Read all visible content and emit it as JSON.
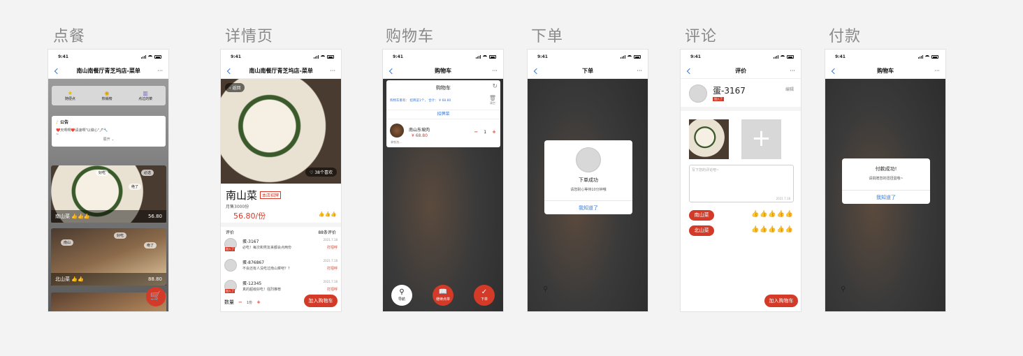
{
  "section_titles": [
    "点餐",
    "详情页",
    "购物车",
    "下单",
    "评论",
    "付款"
  ],
  "status_time": "9:41",
  "more_label": "···",
  "screens": {
    "order": {
      "nav_title": "南山南餐厅青芝坞店-菜单",
      "shortcuts": [
        {
          "icon": "star-icon",
          "label": "随便点"
        },
        {
          "icon": "medal-icon",
          "label": "热销榜"
        },
        {
          "icon": "chart-icon",
          "label": "点过的菜"
        }
      ],
      "notice_title": "公告",
      "notice_text": "❤️天啊啊❤️请速啊\"以做心\"🖊🔧",
      "notice_dash": "~",
      "notice_expand": "展开",
      "dishes": [
        {
          "name": "南山菜",
          "price": "56.80",
          "tags": [
            "好吃",
            "必选",
            "绝了"
          ]
        },
        {
          "name": "北山菜",
          "price": "88.80",
          "tags": [
            "好吃",
            "绝了",
            "南山"
          ]
        }
      ]
    },
    "detail": {
      "nav_title": "南山南餐厅青芝坞店-菜单",
      "back_label": "返回",
      "likes": "38个喜欢",
      "dish_name": "南山菜",
      "badge": "本店招牌",
      "monthly_sales": "月售3000份",
      "price": "56.80/份",
      "reviews_title": "评价",
      "reviews_count": "88条评价",
      "reviews": [
        {
          "user": "蛋-3167",
          "text": "必吃！每次和男友来都会点两份",
          "date": "2021.7.18",
          "tag": "打招呼",
          "badge": "加入了"
        },
        {
          "user": "蛋-876867",
          "text": "不会还有人没吃过南山菜吧？？",
          "date": "2021.7.18",
          "tag": "打招呼",
          "badge": ""
        },
        {
          "user": "蛋-12345",
          "text": "真的超级好吃！强烈推荐",
          "date": "2021.7.18",
          "tag": "打招呼",
          "badge": "加入了"
        }
      ],
      "qty_label": "数量",
      "qty_value": "1份",
      "add_cart": "加入购物车"
    },
    "cart": {
      "nav_title": "购物车",
      "panel_title": "购物车",
      "summary": "购物车重有：  招牌菜1个，  合计：  ¥ 68.80",
      "clear_label": "清空",
      "section": "招牌菜",
      "item_name": "南山东坡肉",
      "item_price": "¥ 68.80",
      "item_qty": "1",
      "item_note": "拿铁泡...",
      "bottom": [
        {
          "icon": "pin-icon",
          "label": "导航"
        },
        {
          "icon": "book-icon",
          "label": "继续点单"
        },
        {
          "icon": "check-icon",
          "label": "下单"
        }
      ]
    },
    "placed": {
      "nav_title": "下单",
      "dialog_title": "下单成功",
      "dialog_text": "请您耐心等待10分钟哦",
      "dialog_btn": "我知道了"
    },
    "review": {
      "nav_title": "评价",
      "user": "蛋-3167",
      "edit": "编辑",
      "badge": "加入了",
      "placeholder": "写下您的评论吧~",
      "date": "2021.7.18",
      "dish_tags": [
        {
          "name": "南山菜",
          "stars": 3
        },
        {
          "name": "北山菜",
          "stars": 3
        }
      ],
      "add_cart": "加入购物车"
    },
    "pay": {
      "nav_title": "购物车",
      "dialog_title": "付款成功!",
      "dialog_text": "请捐赠您的扭扭蛋哦~",
      "dialog_btn": "我知道了"
    }
  },
  "colors": {
    "accent_red": "#d43a28",
    "link_blue": "#3a7bd5",
    "thumb_gold": "#f2b21b"
  }
}
